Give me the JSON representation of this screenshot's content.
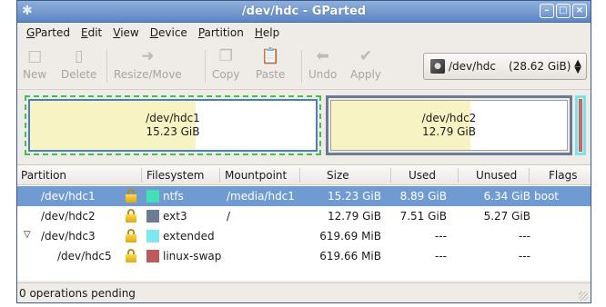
{
  "window": {
    "title": "/dev/hdc - GParted"
  },
  "menu": [
    {
      "label": "GParted",
      "accel": "G",
      "rest": "Parted"
    },
    {
      "label": "Edit",
      "accel": "E",
      "rest": "dit"
    },
    {
      "label": "View",
      "accel": "V",
      "rest": "iew"
    },
    {
      "label": "Device",
      "accel": "D",
      "rest": "evice"
    },
    {
      "label": "Partition",
      "accel": "P",
      "rest": "artition"
    },
    {
      "label": "Help",
      "accel": "H",
      "rest": "elp"
    }
  ],
  "toolbar": {
    "new": "New",
    "delete": "Delete",
    "resize_move": "Resize/Move",
    "copy": "Copy",
    "paste": "Paste",
    "undo": "Undo",
    "apply": "Apply"
  },
  "device": {
    "name": "/dev/hdc",
    "size": "(28.62 GiB)"
  },
  "diskmap": {
    "p1": {
      "name": "/dev/hdc1",
      "size": "15.23 GiB",
      "used_fraction": 0.58
    },
    "p2": {
      "name": "/dev/hdc2",
      "size": "12.79 GiB",
      "used_fraction": 0.59
    }
  },
  "table": {
    "headers": [
      "Partition",
      "Filesystem",
      "Mountpoint",
      "Size",
      "Used",
      "Unused",
      "Flags"
    ],
    "rows": [
      {
        "partition": "/dev/hdc1",
        "filesystem": "ntfs",
        "mountpoint": "/media/hdc1",
        "size": "15.23 GiB",
        "used": "8.89 GiB",
        "unused": "6.34 GiB",
        "flags": "boot",
        "color": "#42e0b8"
      },
      {
        "partition": "/dev/hdc2",
        "filesystem": "ext3",
        "mountpoint": "/",
        "size": "12.79 GiB",
        "used": "7.51 GiB",
        "unused": "5.27 GiB",
        "flags": "",
        "color": "#6b7b93"
      },
      {
        "partition": "/dev/hdc3",
        "filesystem": "extended",
        "mountpoint": "",
        "size": "619.69 MiB",
        "used": "---",
        "unused": "---",
        "flags": "",
        "color": "#7ee8f0"
      },
      {
        "partition": "/dev/hdc5",
        "filesystem": "linux-swap",
        "mountpoint": "",
        "size": "619.66 MiB",
        "used": "---",
        "unused": "---",
        "flags": "",
        "color": "#c05a5a"
      }
    ]
  },
  "status": {
    "text": "0 operations pending"
  }
}
